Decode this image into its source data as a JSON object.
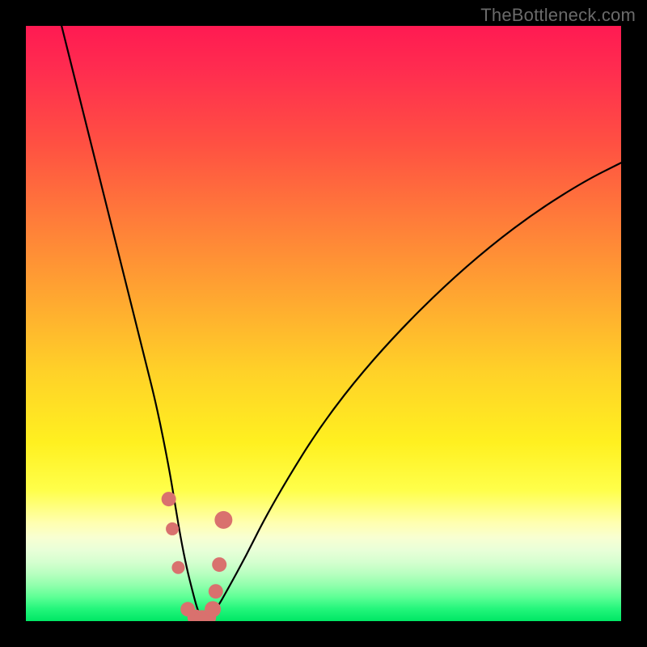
{
  "watermark": "TheBottleneck.com",
  "colors": {
    "frame": "#000000",
    "curve": "#000000",
    "marker_fill": "#d9716e",
    "marker_stroke": "#c65b58"
  },
  "chart_data": {
    "type": "line",
    "title": "",
    "xlabel": "",
    "ylabel": "",
    "xlim": [
      0,
      100
    ],
    "ylim": [
      0,
      100
    ],
    "curve": {
      "x": [
        6,
        8,
        10,
        12,
        14,
        16,
        18,
        20,
        22,
        24,
        25,
        26,
        27,
        28,
        28.8,
        29.5,
        30.5,
        32,
        34,
        37,
        40,
        44,
        49,
        55,
        62,
        70,
        78,
        86,
        94,
        100
      ],
      "y": [
        100,
        92,
        84,
        76,
        68,
        60,
        52,
        44,
        36,
        26,
        20,
        14,
        9,
        5,
        2,
        0.5,
        0.5,
        2,
        5.5,
        11,
        17,
        24,
        32,
        40,
        48,
        56,
        63,
        69,
        74,
        77
      ]
    },
    "markers": {
      "x": [
        24.0,
        24.6,
        25.6,
        27.2,
        28.5,
        29.6,
        30.6,
        31.4,
        31.9,
        32.5,
        33.2
      ],
      "y": [
        20.5,
        15.5,
        9.0,
        2.0,
        0.6,
        0.5,
        0.6,
        2.0,
        5.0,
        9.5,
        17.0
      ],
      "r": [
        9,
        8,
        8,
        9,
        10,
        10,
        10,
        10,
        9,
        9,
        11
      ]
    }
  }
}
